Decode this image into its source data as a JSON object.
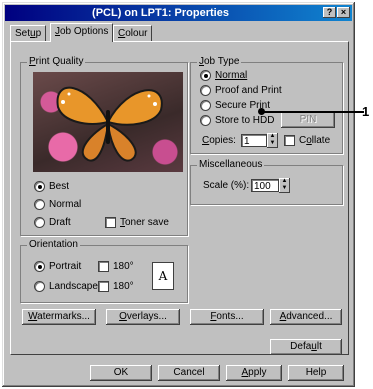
{
  "window": {
    "title": "(PCL) on LPT1: Properties",
    "help": "?",
    "close": "×"
  },
  "tabs": [
    {
      "pre": "Set",
      "u": "u",
      "post": "p"
    },
    {
      "pre": "",
      "u": "J",
      "post": "ob Options"
    },
    {
      "pre": "",
      "u": "C",
      "post": "olour"
    }
  ],
  "print_quality": {
    "legend_pre": "",
    "legend_u": "P",
    "legend_post": "rint Quality",
    "options": [
      {
        "label": "Best",
        "selected": true
      },
      {
        "label": "Normal",
        "selected": false
      },
      {
        "label": "Draft",
        "selected": false
      }
    ],
    "toner_save": {
      "pre": "",
      "u": "T",
      "post": "oner save",
      "checked": false
    }
  },
  "orientation": {
    "legend": "Orientation",
    "portrait": {
      "label": "Portrait",
      "selected": true
    },
    "landscape": {
      "label": "Landscape",
      "selected": false
    },
    "rotate1": {
      "label": "180°",
      "checked": false
    },
    "rotate2": {
      "label": "180°",
      "checked": false
    },
    "icon_letter": "A"
  },
  "job_type": {
    "legend_pre": "",
    "legend_u": "J",
    "legend_post": "ob Type",
    "options": [
      {
        "label": "Normal",
        "selected": true
      },
      {
        "label": "Proof and Print",
        "selected": false
      },
      {
        "label": "Secure Print",
        "selected": false
      },
      {
        "label": "Store to HDD",
        "selected": false
      }
    ],
    "pin_button": "PIN",
    "copies_label_u": "C",
    "copies_label_rest": "opies:",
    "copies_value": "1",
    "collate": {
      "pre": "C",
      "u": "o",
      "post": "llate",
      "checked": false
    }
  },
  "misc": {
    "legend": "Miscellaneous",
    "scale_label": "Scale (%):",
    "scale_value": "100"
  },
  "buttons_row": [
    {
      "pre": "",
      "u": "W",
      "post": "atermarks..."
    },
    {
      "pre": "",
      "u": "O",
      "post": "verlays..."
    },
    {
      "pre": "",
      "u": "F",
      "post": "onts..."
    },
    {
      "pre": "",
      "u": "A",
      "post": "dvanced..."
    }
  ],
  "default_button": {
    "pre": "Defa",
    "u": "u",
    "post": "lt"
  },
  "footer": {
    "ok": "OK",
    "cancel": "Cancel",
    "apply_u": "A",
    "apply_rest": "pply",
    "help": "Help"
  },
  "callout": "1"
}
